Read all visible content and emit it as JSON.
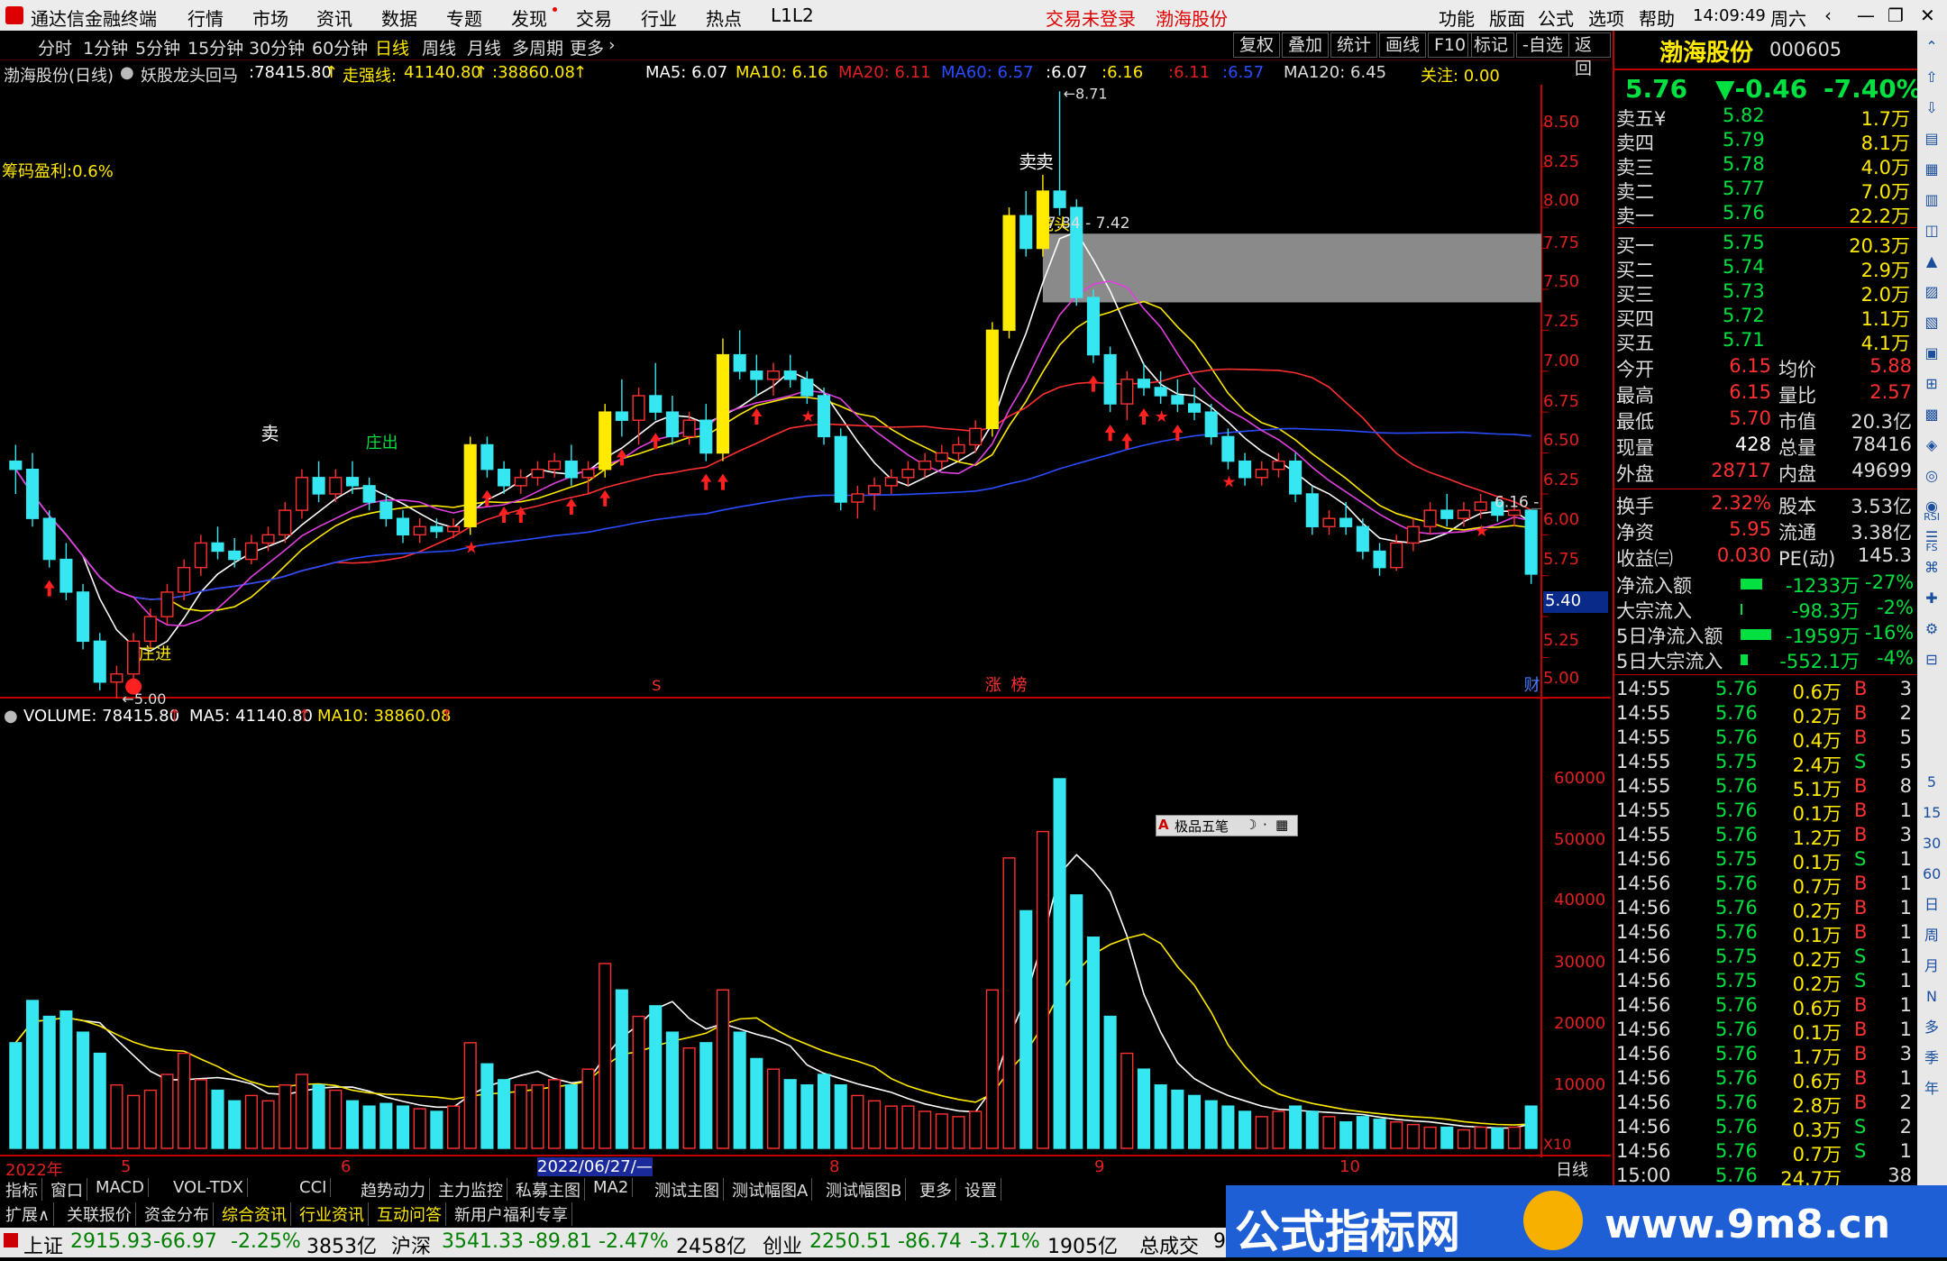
{
  "titlebar": {
    "app_name": "通达信金融终端",
    "menus": [
      "行情",
      "市场",
      "资讯",
      "数据",
      "专题",
      "发现",
      "交易",
      "行业",
      "热点",
      "L1L2"
    ],
    "login_status": "交易未登录",
    "stock_name": "渤海股份",
    "right_menus": [
      "功能",
      "版面",
      "公式",
      "选项",
      "帮助"
    ],
    "time": "14:09:49",
    "weekday": "周六"
  },
  "periods": [
    "分时",
    "1分钟",
    "5分钟",
    "15分钟",
    "30分钟",
    "60分钟",
    "日线",
    "周线",
    "月线",
    "多周期",
    "更多"
  ],
  "selected_period": "日线",
  "toolbar_buttons": [
    "复权",
    "叠加",
    "统计",
    "画线",
    "F10",
    "标记",
    "-自选",
    "返回"
  ],
  "chart_header": {
    "stock": "渤海股份(日线)",
    "formula": "妖股龙头回马",
    "v1": ":78415.80",
    "v2_label": "走强线:",
    "v2": "41140.80",
    "v3": ":38860.08",
    "ma5": "MA5: 6.07",
    "ma10": "MA10: 6.16",
    "ma20": "MA20: 6.11",
    "ma60": "MA60: 6.57",
    "r1": ":6.07",
    "r2": ":6.16",
    "r3": ":6.11",
    "r4": ":6.57",
    "ma120": "MA120: 6.45",
    "focus": "关注: 0.00"
  },
  "chip_profit": "筹码盈利:0.6%",
  "price_axis": [
    "8.50",
    "8.25",
    "8.00",
    "7.75",
    "7.50",
    "7.25",
    "7.00",
    "6.75",
    "6.50",
    "6.25",
    "6.00",
    "5.75",
    "5.50",
    "5.25",
    "5.00"
  ],
  "price_box": "5.40",
  "annotations": {
    "high": "8.71",
    "low": "5.00",
    "zone": "7.84 - 7.42",
    "last": "6.16",
    "sell": "卖",
    "dragon": "龙头",
    "zhuangjin": "庄进",
    "zhuangchu": "庄出",
    "zhang": "涨",
    "bang": "榜",
    "cai": "财",
    "s_mark": "S"
  },
  "volume_header": {
    "label": "VOLUME: 78415.80",
    "ma5": "MA5: 41140.80",
    "ma10": "MA10: 38860.08"
  },
  "volume_axis": [
    "60000",
    "50000",
    "40000",
    "30000",
    "20000",
    "10000"
  ],
  "volume_unit": "X10",
  "floating_toolbar": "极品五笔",
  "date_axis": {
    "y": "2022年",
    "m5": "5",
    "m6": "6",
    "sel": "2022/06/27/—",
    "m8": "8",
    "m9": "9",
    "m10": "10",
    "period": "日线"
  },
  "tabs_row1": [
    "指标",
    "窗口",
    "MACD",
    "VOL-TDX",
    "CCI",
    "趋势动力",
    "主力监控",
    "私募主图",
    "MA2",
    "测试主图",
    "测试幅图A",
    "测试幅图B",
    "更多",
    "设置"
  ],
  "tabs_row2": [
    "扩展∧",
    "关联报价",
    "资金分布",
    "综合资讯",
    "行业资讯",
    "互动问答",
    "新用户福利专享"
  ],
  "quote": {
    "name": "渤海股份",
    "code": "000605",
    "price": "5.76",
    "change": "▼-0.46",
    "pct": "-7.40%",
    "asks": [
      {
        "label": "卖五¥",
        "price": "5.82",
        "vol": "1.7万"
      },
      {
        "label": "卖四",
        "price": "5.79",
        "vol": "8.1万"
      },
      {
        "label": "卖三",
        "price": "5.78",
        "vol": "4.0万"
      },
      {
        "label": "卖二",
        "price": "5.77",
        "vol": "7.0万"
      },
      {
        "label": "卖一",
        "price": "5.76",
        "vol": "22.2万"
      }
    ],
    "bids": [
      {
        "label": "买一",
        "price": "5.75",
        "vol": "20.3万"
      },
      {
        "label": "买二",
        "price": "5.74",
        "vol": "2.9万"
      },
      {
        "label": "买三",
        "price": "5.73",
        "vol": "2.0万"
      },
      {
        "label": "买四",
        "price": "5.72",
        "vol": "1.1万"
      },
      {
        "label": "买五",
        "price": "5.71",
        "vol": "4.1万"
      }
    ],
    "stats": [
      {
        "l1": "今开",
        "v1": "6.15",
        "l2": "均价",
        "v2": "5.88"
      },
      {
        "l1": "最高",
        "v1": "6.15",
        "l2": "量比",
        "v2": "2.57"
      },
      {
        "l1": "最低",
        "v1": "5.70",
        "l2": "市值",
        "v2": "20.3亿"
      },
      {
        "l1": "现量",
        "v1": "428",
        "l2": "总量",
        "v2": "78416"
      },
      {
        "l1": "外盘",
        "v1": "28717",
        "l2": "内盘",
        "v2": "49699"
      }
    ],
    "stats2": [
      {
        "l1": "换手",
        "v1": "2.32%",
        "l2": "股本",
        "v2": "3.53亿"
      },
      {
        "l1": "净资",
        "v1": "5.95",
        "l2": "流通",
        "v2": "3.38亿"
      },
      {
        "l1": "收益㈢",
        "v1": "0.030",
        "l2": "PE(动)",
        "v2": "145.3"
      }
    ],
    "flows": [
      {
        "label": "净流入额",
        "val": "-1233万",
        "pct": "-27%"
      },
      {
        "label": "大宗流入",
        "val": "-98.3万",
        "pct": "-2%"
      },
      {
        "label": "5日净流入额",
        "val": "-1959万",
        "pct": "-16%"
      },
      {
        "label": "5日大宗流入",
        "val": "-552.1万",
        "pct": "-4%"
      }
    ],
    "ticks": [
      {
        "t": "14:55",
        "p": "5.76",
        "v": "0.6万",
        "d": "B",
        "n": "3"
      },
      {
        "t": "14:55",
        "p": "5.76",
        "v": "0.2万",
        "d": "B",
        "n": "2"
      },
      {
        "t": "14:55",
        "p": "5.76",
        "v": "0.4万",
        "d": "B",
        "n": "5"
      },
      {
        "t": "14:55",
        "p": "5.75",
        "v": "2.4万",
        "d": "S",
        "n": "5"
      },
      {
        "t": "14:55",
        "p": "5.76",
        "v": "5.1万",
        "d": "B",
        "n": "8"
      },
      {
        "t": "14:55",
        "p": "5.76",
        "v": "0.1万",
        "d": "B",
        "n": "1"
      },
      {
        "t": "14:55",
        "p": "5.76",
        "v": "1.2万",
        "d": "B",
        "n": "3"
      },
      {
        "t": "14:56",
        "p": "5.75",
        "v": "0.1万",
        "d": "S",
        "n": "1"
      },
      {
        "t": "14:56",
        "p": "5.76",
        "v": "0.7万",
        "d": "B",
        "n": "1"
      },
      {
        "t": "14:56",
        "p": "5.76",
        "v": "0.2万",
        "d": "B",
        "n": "1"
      },
      {
        "t": "14:56",
        "p": "5.76",
        "v": "0.1万",
        "d": "B",
        "n": "1"
      },
      {
        "t": "14:56",
        "p": "5.75",
        "v": "0.2万",
        "d": "S",
        "n": "1"
      },
      {
        "t": "14:56",
        "p": "5.75",
        "v": "0.2万",
        "d": "S",
        "n": "1"
      },
      {
        "t": "14:56",
        "p": "5.76",
        "v": "0.6万",
        "d": "B",
        "n": "1"
      },
      {
        "t": "14:56",
        "p": "5.76",
        "v": "0.1万",
        "d": "B",
        "n": "1"
      },
      {
        "t": "14:56",
        "p": "5.76",
        "v": "1.7万",
        "d": "B",
        "n": "3"
      },
      {
        "t": "14:56",
        "p": "5.76",
        "v": "0.6万",
        "d": "B",
        "n": "1"
      },
      {
        "t": "14:56",
        "p": "5.76",
        "v": "2.8万",
        "d": "B",
        "n": "2"
      },
      {
        "t": "14:56",
        "p": "5.76",
        "v": "0.3万",
        "d": "S",
        "n": "2"
      },
      {
        "t": "14:56",
        "p": "5.76",
        "v": "0.7万",
        "d": "S",
        "n": "1"
      },
      {
        "t": "15:00",
        "p": "5.76",
        "v": "24.7万",
        "d": "",
        "n": "38"
      }
    ]
  },
  "side_icons": [
    "日",
    "周",
    "月",
    "N",
    "多",
    "季",
    "年"
  ],
  "side_numbers": [
    "5",
    "15",
    "30",
    "60"
  ],
  "side_labels": [
    "RSI",
    "FS"
  ],
  "status": {
    "sh_label": "上证",
    "sh": "2915.93",
    "sh_chg": "-66.97",
    "sh_pct": "-2.25%",
    "sh_amt": "3853亿",
    "hs_label": "沪深",
    "hs": "3541.33",
    "hs_chg": "-89.81",
    "hs_pct": "-2.47%",
    "hs_amt": "2458亿",
    "cy_label": "创业",
    "cy": "2250.51",
    "cy_chg": "-86.74",
    "cy_pct": "-3.71%",
    "cy_amt": "1905亿",
    "total_label": "总成交",
    "total": "9"
  },
  "watermark": {
    "text": "公式指标网",
    "url": "www.9m8.cn"
  },
  "chart_data": {
    "type": "candlestick",
    "price_range": [
      4.95,
      8.75
    ],
    "volume_range": [
      0,
      70000
    ],
    "candles": [
      [
        6.45,
        6.55,
        6.25,
        6.4,
        20000
      ],
      [
        6.4,
        6.5,
        6.05,
        6.1,
        28000
      ],
      [
        6.1,
        6.15,
        5.8,
        5.85,
        25000
      ],
      [
        5.85,
        5.95,
        5.6,
        5.65,
        26000
      ],
      [
        5.65,
        5.7,
        5.3,
        5.35,
        22000
      ],
      [
        5.35,
        5.4,
        5.05,
        5.1,
        18000
      ],
      [
        5.1,
        5.2,
        5.0,
        5.15,
        12000
      ],
      [
        5.15,
        5.4,
        5.1,
        5.35,
        10000
      ],
      [
        5.35,
        5.55,
        5.3,
        5.5,
        11000
      ],
      [
        5.5,
        5.7,
        5.45,
        5.65,
        14000
      ],
      [
        5.65,
        5.85,
        5.6,
        5.8,
        18000
      ],
      [
        5.8,
        6.0,
        5.75,
        5.95,
        13000
      ],
      [
        5.95,
        6.05,
        5.85,
        5.9,
        11000
      ],
      [
        5.9,
        5.98,
        5.8,
        5.85,
        9000
      ],
      [
        5.85,
        6.0,
        5.82,
        5.95,
        10000
      ],
      [
        5.95,
        6.05,
        5.9,
        6.0,
        9000
      ],
      [
        6.0,
        6.2,
        5.95,
        6.15,
        12000
      ],
      [
        6.15,
        6.4,
        6.1,
        6.35,
        14000
      ],
      [
        6.35,
        6.45,
        6.2,
        6.25,
        12000
      ],
      [
        6.25,
        6.4,
        6.2,
        6.35,
        11000
      ],
      [
        6.35,
        6.45,
        6.25,
        6.3,
        9000
      ],
      [
        6.3,
        6.35,
        6.15,
        6.2,
        8000
      ],
      [
        6.2,
        6.25,
        6.05,
        6.1,
        8500
      ],
      [
        6.1,
        6.15,
        5.95,
        6.0,
        8000
      ],
      [
        6.0,
        6.1,
        5.95,
        6.05,
        7500
      ],
      [
        6.05,
        6.1,
        5.98,
        6.02,
        7000
      ],
      [
        6.02,
        6.1,
        5.98,
        6.05,
        8000
      ],
      [
        6.05,
        6.6,
        6.0,
        6.55,
        20000
      ],
      [
        6.55,
        6.6,
        6.35,
        6.4,
        16000
      ],
      [
        6.4,
        6.45,
        6.25,
        6.3,
        13000
      ],
      [
        6.3,
        6.4,
        6.25,
        6.35,
        12000
      ],
      [
        6.35,
        6.45,
        6.3,
        6.4,
        12000
      ],
      [
        6.4,
        6.5,
        6.35,
        6.45,
        13000
      ],
      [
        6.45,
        6.55,
        6.3,
        6.35,
        12000
      ],
      [
        6.35,
        6.45,
        6.25,
        6.4,
        15000
      ],
      [
        6.4,
        6.8,
        6.35,
        6.75,
        35000
      ],
      [
        6.75,
        6.95,
        6.6,
        6.7,
        30000
      ],
      [
        6.7,
        6.9,
        6.55,
        6.85,
        25000
      ],
      [
        6.85,
        7.05,
        6.7,
        6.75,
        27000
      ],
      [
        6.75,
        6.85,
        6.55,
        6.6,
        22000
      ],
      [
        6.6,
        6.75,
        6.55,
        6.7,
        19000
      ],
      [
        6.7,
        6.8,
        6.45,
        6.5,
        20000
      ],
      [
        6.5,
        7.2,
        6.45,
        7.1,
        30000
      ],
      [
        7.1,
        7.25,
        6.95,
        7.0,
        22000
      ],
      [
        7.0,
        7.1,
        6.85,
        6.95,
        17000
      ],
      [
        6.95,
        7.05,
        6.85,
        7.0,
        15000
      ],
      [
        7.0,
        7.1,
        6.9,
        6.95,
        13000
      ],
      [
        6.95,
        7.0,
        6.8,
        6.85,
        12000
      ],
      [
        6.85,
        6.9,
        6.55,
        6.6,
        14000
      ],
      [
        6.6,
        6.65,
        6.15,
        6.2,
        12000
      ],
      [
        6.2,
        6.3,
        6.1,
        6.25,
        10000
      ],
      [
        6.25,
        6.35,
        6.15,
        6.3,
        9000
      ],
      [
        6.3,
        6.4,
        6.25,
        6.35,
        8000
      ],
      [
        6.35,
        6.45,
        6.3,
        6.4,
        8000
      ],
      [
        6.4,
        6.5,
        6.35,
        6.45,
        7000
      ],
      [
        6.45,
        6.55,
        6.4,
        6.5,
        6500
      ],
      [
        6.5,
        6.6,
        6.45,
        6.55,
        6000
      ],
      [
        6.55,
        6.7,
        6.5,
        6.65,
        7000
      ],
      [
        6.65,
        7.3,
        6.6,
        7.25,
        30000
      ],
      [
        7.25,
        8.0,
        7.2,
        7.95,
        55000
      ],
      [
        7.95,
        8.1,
        7.7,
        7.75,
        45000
      ],
      [
        7.75,
        8.2,
        7.7,
        8.1,
        60000
      ],
      [
        8.1,
        8.71,
        7.95,
        8.0,
        70000
      ],
      [
        8.0,
        8.05,
        7.4,
        7.45,
        48000
      ],
      [
        7.45,
        7.5,
        7.05,
        7.1,
        40000
      ],
      [
        7.1,
        7.15,
        6.75,
        6.8,
        25000
      ],
      [
        6.8,
        7.0,
        6.7,
        6.95,
        18000
      ],
      [
        6.95,
        7.05,
        6.85,
        6.9,
        15000
      ],
      [
        6.9,
        7.0,
        6.8,
        6.85,
        12000
      ],
      [
        6.85,
        6.95,
        6.75,
        6.8,
        11000
      ],
      [
        6.8,
        6.9,
        6.7,
        6.75,
        10000
      ],
      [
        6.75,
        6.8,
        6.55,
        6.6,
        9000
      ],
      [
        6.6,
        6.65,
        6.4,
        6.45,
        8000
      ],
      [
        6.45,
        6.5,
        6.3,
        6.35,
        7000
      ],
      [
        6.35,
        6.45,
        6.3,
        6.4,
        6000
      ],
      [
        6.4,
        6.5,
        6.35,
        6.45,
        7000
      ],
      [
        6.45,
        6.5,
        6.2,
        6.25,
        8000
      ],
      [
        6.25,
        6.3,
        6.0,
        6.05,
        7000
      ],
      [
        6.05,
        6.15,
        6.0,
        6.1,
        6000
      ],
      [
        6.1,
        6.2,
        6.0,
        6.05,
        5000
      ],
      [
        6.05,
        6.1,
        5.85,
        5.9,
        6000
      ],
      [
        5.9,
        5.95,
        5.75,
        5.8,
        5500
      ],
      [
        5.8,
        6.0,
        5.78,
        5.95,
        5000
      ],
      [
        5.95,
        6.1,
        5.9,
        6.05,
        4500
      ],
      [
        6.05,
        6.2,
        6.0,
        6.15,
        4000
      ],
      [
        6.15,
        6.25,
        6.05,
        6.1,
        4000
      ],
      [
        6.1,
        6.2,
        6.05,
        6.15,
        3500
      ],
      [
        6.15,
        6.25,
        6.1,
        6.2,
        4000
      ],
      [
        6.2,
        6.22,
        6.08,
        6.12,
        3800
      ],
      [
        6.12,
        6.2,
        6.05,
        6.15,
        4000
      ],
      [
        6.15,
        6.15,
        5.7,
        5.76,
        8000
      ]
    ]
  }
}
